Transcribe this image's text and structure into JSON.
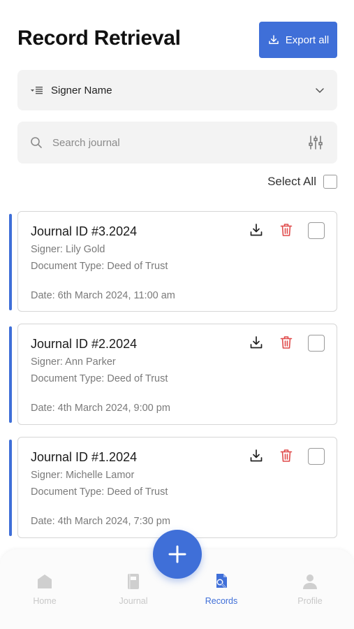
{
  "header": {
    "title": "Record Retrieval",
    "export_label": "Export all"
  },
  "filter": {
    "label": "Signer Name"
  },
  "search": {
    "placeholder": "Search journal",
    "value": ""
  },
  "select_all": {
    "label": "Select All"
  },
  "records": [
    {
      "journal_id": "Journal ID #3.2024",
      "signer": "Signer: Lily Gold",
      "doc_type": "Document Type: Deed of Trust",
      "date": "Date:  6th March 2024, 11:00 am"
    },
    {
      "journal_id": "Journal ID #2.2024",
      "signer": "Signer: Ann Parker",
      "doc_type": "Document Type: Deed of Trust",
      "date": "Date:  4th March 2024, 9:00 pm"
    },
    {
      "journal_id": "Journal ID #1.2024",
      "signer": "Signer: Michelle Lamor",
      "doc_type": "Document Type: Deed of Trust",
      "date": "Date:  4th March 2024, 7:30 pm"
    }
  ],
  "nav": {
    "home": "Home",
    "journal": "Journal",
    "records": "Records",
    "profile": "Profile",
    "active": "records"
  },
  "colors": {
    "accent": "#3f6fd8",
    "delete": "#e04b4b",
    "inactive": "#c8c8c8"
  }
}
